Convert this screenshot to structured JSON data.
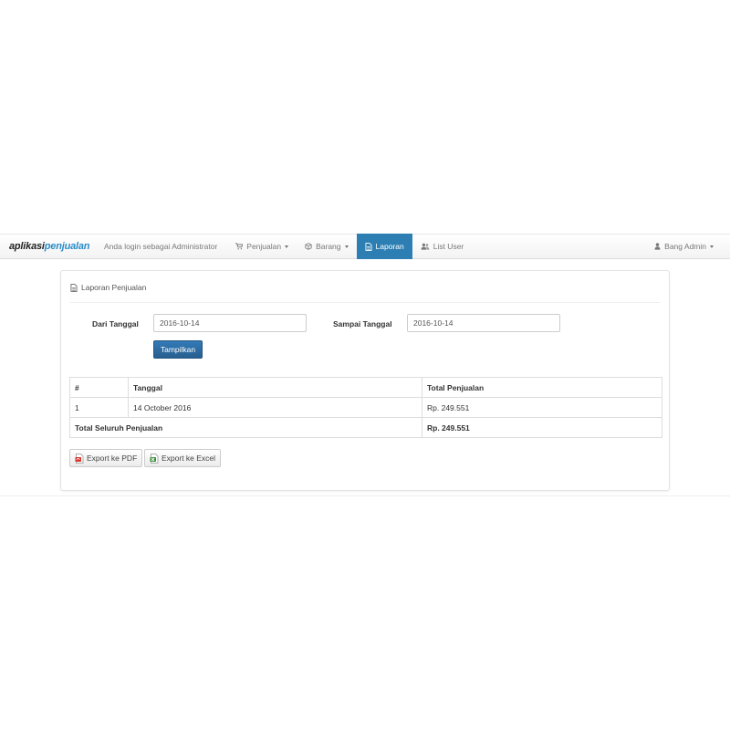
{
  "navbar": {
    "brand_part1": "aplikasi",
    "brand_part2": "penjualan",
    "login_text": "Anda login sebagai Administrator",
    "items": [
      {
        "label": "Penjualan",
        "icon": "cart-icon"
      },
      {
        "label": "Barang",
        "icon": "box-icon"
      },
      {
        "label": "Laporan",
        "icon": "document-icon",
        "active": true
      },
      {
        "label": "List User",
        "icon": "users-icon"
      }
    ],
    "user": {
      "label": "Bang Admin",
      "icon": "user-icon"
    }
  },
  "panel": {
    "title": "Laporan Penjualan",
    "from_label": "Dari Tanggal",
    "from_value": "2016-10-14",
    "to_label": "Sampai Tanggal",
    "to_value": "2016-10-14",
    "submit_label": "Tampilkan"
  },
  "table": {
    "headers": [
      "#",
      "Tanggal",
      "Total Penjualan"
    ],
    "rows": [
      {
        "no": "1",
        "date": "14 October 2016",
        "total": "Rp. 249.551"
      }
    ],
    "footer_label": "Total Seluruh Penjualan",
    "footer_total": "Rp. 249.551"
  },
  "export": {
    "pdf_label": "Export ke PDF",
    "excel_label": "Export ke Excel"
  },
  "colors": {
    "accent": "#2d7fb3",
    "brand_blue": "#2a8cc7",
    "pdf_red": "#d9352b",
    "excel_green": "#3a8f3a"
  }
}
